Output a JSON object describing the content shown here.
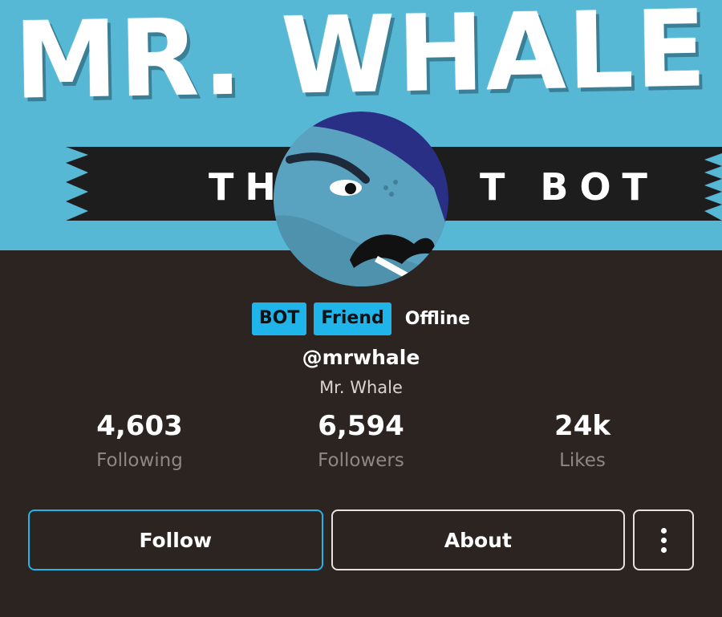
{
  "banner": {
    "title": "MR. WHALE",
    "subtitle": "TH        T BOT"
  },
  "profile": {
    "badges": [
      "BOT",
      "Friend"
    ],
    "status": "Offline",
    "handle": "@mrwhale",
    "display_name": "Mr. Whale"
  },
  "stats": [
    {
      "value": "4,603",
      "label": "Following"
    },
    {
      "value": "6,594",
      "label": "Followers"
    },
    {
      "value": "24k",
      "label": "Likes"
    }
  ],
  "actions": {
    "follow_label": "Follow",
    "about_label": "About",
    "more_icon": "vertical-ellipsis-icon"
  },
  "colors": {
    "banner_bg": "#57b8d6",
    "page_bg": "#2b2421",
    "accent": "#1fb4ea"
  }
}
